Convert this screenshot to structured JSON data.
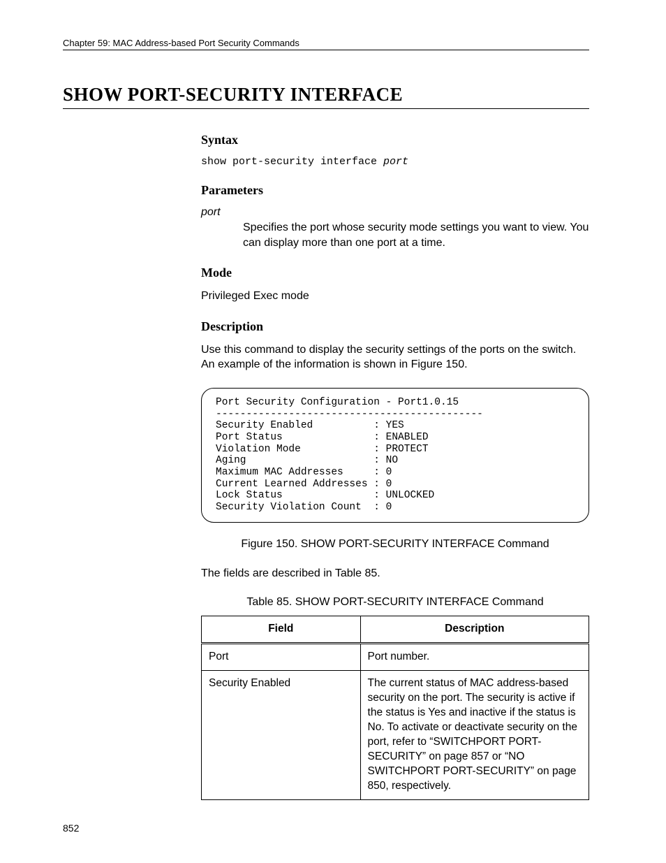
{
  "chapter": "Chapter 59: MAC Address-based Port Security Commands",
  "title": "SHOW PORT-SECURITY INTERFACE",
  "sections": {
    "syntax_heading": "Syntax",
    "syntax_cmd": "show port-security interface ",
    "syntax_arg": "port",
    "parameters_heading": "Parameters",
    "param_name": "port",
    "param_desc": "Specifies the port whose security mode settings you want to view. You can display more than one port at a time.",
    "mode_heading": "Mode",
    "mode_text": "Privileged Exec mode",
    "description_heading": "Description",
    "description_text": "Use this command to display the security settings of the ports on the switch. An example of the information is shown in Figure 150.",
    "after_figure_text": "The fields are described in Table 85.",
    "figure_caption": "Figure 150. SHOW PORT-SECURITY INTERFACE Command",
    "table_caption": "Table 85. SHOW PORT-SECURITY INTERFACE Command"
  },
  "output_box": "Port Security Configuration - Port1.0.15\n--------------------------------------------\nSecurity Enabled          : YES\nPort Status               : ENABLED\nViolation Mode            : PROTECT\nAging                     : NO\nMaximum MAC Addresses     : 0\nCurrent Learned Addresses : 0\nLock Status               : UNLOCKED\nSecurity Violation Count  : 0",
  "table": {
    "headers": {
      "field": "Field",
      "description": "Description"
    },
    "rows": [
      {
        "field": "Port",
        "description": "Port number."
      },
      {
        "field": "Security Enabled",
        "description": "The current status of MAC address-based security on the port. The security is active if the status is Yes and inactive if the status is No. To activate or deactivate security on the port, refer to “SWITCHPORT PORT-SECURITY” on page 857 or “NO SWITCHPORT PORT-SECURITY” on page 850, respectively."
      }
    ]
  },
  "page_number": "852"
}
